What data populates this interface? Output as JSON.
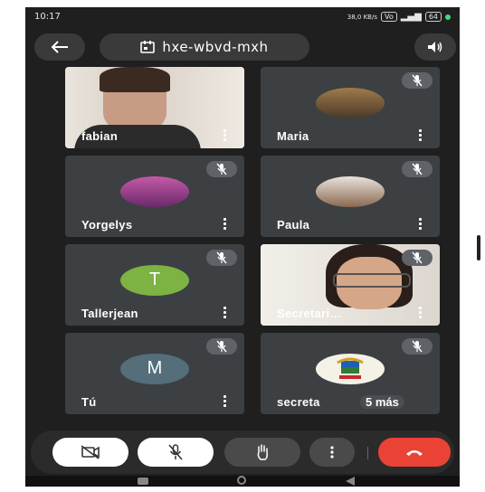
{
  "status_bar": {
    "time": "10:17",
    "net": "38,0 KB/s",
    "volte": "Vo",
    "battery": "64"
  },
  "header": {
    "meeting_code": "hxe-wbvd-mxh"
  },
  "tiles": [
    {
      "name": "fabian",
      "type": "video",
      "muted": false
    },
    {
      "name": "Maria",
      "type": "photo",
      "muted": true
    },
    {
      "name": "Yorgelys",
      "type": "photo",
      "muted": true
    },
    {
      "name": "Paula",
      "type": "photo",
      "muted": true
    },
    {
      "name": "Tallerjean",
      "type": "letter",
      "letter": "T",
      "muted": true
    },
    {
      "name": "Secretari…",
      "type": "video",
      "muted": true
    },
    {
      "name": "Tú",
      "type": "letter",
      "letter": "M",
      "muted": true
    },
    {
      "name": "secreta",
      "type": "logo",
      "muted": true,
      "extra": "5 más"
    }
  ],
  "colors": {
    "accent_end_call": "#ea4335",
    "avatar_t": "#7cb342",
    "avatar_m": "#546e7a",
    "tile": "#3c4043"
  },
  "icons": [
    "back-arrow-icon",
    "camera-icon",
    "speaker-icon",
    "mic-off-icon",
    "camera-off-icon",
    "raise-hand-icon",
    "more-options-icon",
    "end-call-icon"
  ]
}
